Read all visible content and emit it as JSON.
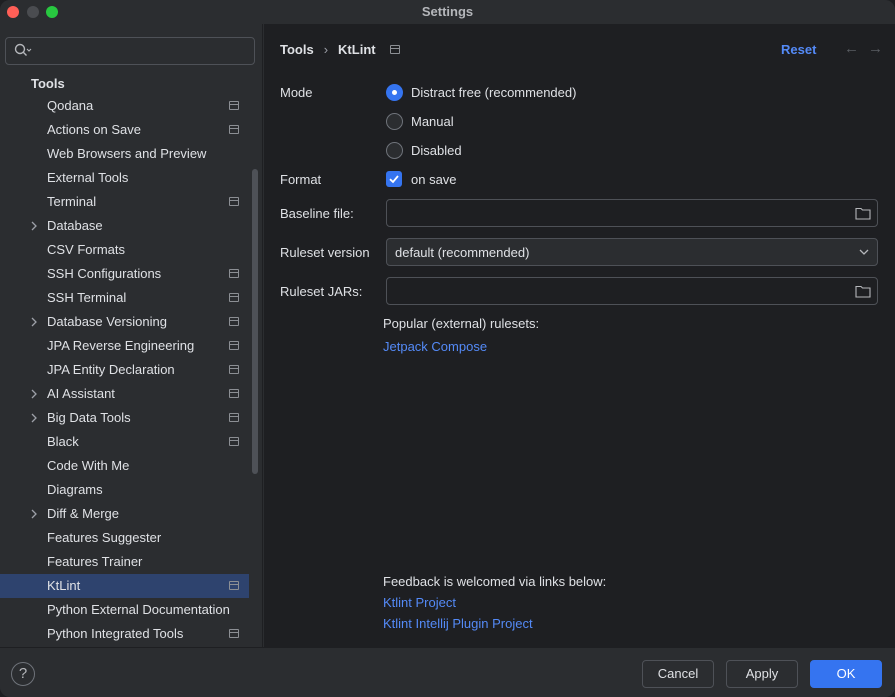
{
  "window": {
    "title": "Settings"
  },
  "sidebar": {
    "search_placeholder": "",
    "section_title": "Tools",
    "items": [
      {
        "label": "Qodana",
        "chevron": false,
        "project_icon": true,
        "selected": false
      },
      {
        "label": "Actions on Save",
        "chevron": false,
        "project_icon": true,
        "selected": false
      },
      {
        "label": "Web Browsers and Preview",
        "chevron": false,
        "project_icon": false,
        "selected": false
      },
      {
        "label": "External Tools",
        "chevron": false,
        "project_icon": false,
        "selected": false
      },
      {
        "label": "Terminal",
        "chevron": false,
        "project_icon": true,
        "selected": false
      },
      {
        "label": "Database",
        "chevron": true,
        "project_icon": false,
        "selected": false
      },
      {
        "label": "CSV Formats",
        "chevron": false,
        "project_icon": false,
        "selected": false
      },
      {
        "label": "SSH Configurations",
        "chevron": false,
        "project_icon": true,
        "selected": false
      },
      {
        "label": "SSH Terminal",
        "chevron": false,
        "project_icon": true,
        "selected": false
      },
      {
        "label": "Database Versioning",
        "chevron": true,
        "project_icon": true,
        "selected": false
      },
      {
        "label": "JPA Reverse Engineering",
        "chevron": false,
        "project_icon": true,
        "selected": false
      },
      {
        "label": "JPA Entity Declaration",
        "chevron": false,
        "project_icon": true,
        "selected": false
      },
      {
        "label": "AI Assistant",
        "chevron": true,
        "project_icon": true,
        "selected": false
      },
      {
        "label": "Big Data Tools",
        "chevron": true,
        "project_icon": true,
        "selected": false
      },
      {
        "label": "Black",
        "chevron": false,
        "project_icon": true,
        "selected": false
      },
      {
        "label": "Code With Me",
        "chevron": false,
        "project_icon": false,
        "selected": false
      },
      {
        "label": "Diagrams",
        "chevron": false,
        "project_icon": false,
        "selected": false
      },
      {
        "label": "Diff & Merge",
        "chevron": true,
        "project_icon": false,
        "selected": false
      },
      {
        "label": "Features Suggester",
        "chevron": false,
        "project_icon": false,
        "selected": false
      },
      {
        "label": "Features Trainer",
        "chevron": false,
        "project_icon": false,
        "selected": false
      },
      {
        "label": "KtLint",
        "chevron": false,
        "project_icon": true,
        "selected": true
      },
      {
        "label": "Python External Documentation",
        "chevron": false,
        "project_icon": false,
        "selected": false
      },
      {
        "label": "Python Integrated Tools",
        "chevron": false,
        "project_icon": true,
        "selected": false
      }
    ]
  },
  "header": {
    "breadcrumb_parent": "Tools",
    "breadcrumb_separator": "›",
    "breadcrumb_current": "KtLint",
    "reset_label": "Reset",
    "back_arrow": "←",
    "forward_arrow": "→"
  },
  "form": {
    "mode_label": "Mode",
    "mode_options": [
      "Distract free (recommended)",
      "Manual",
      "Disabled"
    ],
    "mode_selected": "Distract free (recommended)",
    "format_label": "Format",
    "format_checkbox_label": "on save",
    "format_checked": true,
    "baseline_label": "Baseline file:",
    "baseline_value": "",
    "ruleset_version_label": "Ruleset version",
    "ruleset_version_value": "default (recommended)",
    "ruleset_jars_label": "Ruleset JARs:",
    "ruleset_jars_value": "",
    "popular_rulesets_text": "Popular (external) rulesets:",
    "jetpack_link": "Jetpack Compose",
    "feedback_text": "Feedback is welcomed via links below:",
    "ktlint_project_link": "Ktlint Project",
    "ktlint_plugin_link": "Ktlint Intellij Plugin Project"
  },
  "footer": {
    "help_label": "?",
    "cancel_label": "Cancel",
    "apply_label": "Apply",
    "ok_label": "OK"
  },
  "colors": {
    "accent": "#3574f0",
    "link": "#548af7",
    "selection": "#2e436e",
    "background": "#1e1f22",
    "panel": "#2b2d30"
  }
}
